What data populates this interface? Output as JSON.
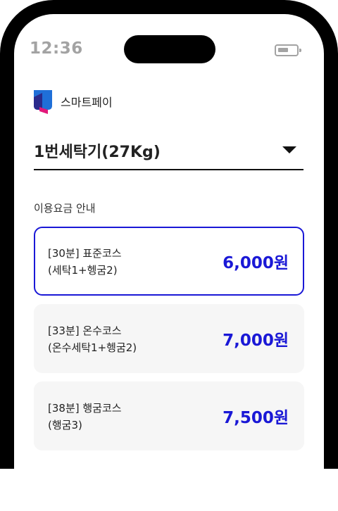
{
  "status_bar": {
    "time": "12:36"
  },
  "brand": {
    "name": "스마트페이"
  },
  "machine_select": {
    "label": "1번세탁기(27Kg)"
  },
  "section": {
    "title": "이용요금 안내"
  },
  "courses": [
    {
      "name": "[30분] 표준코스",
      "detail": "(세탁1+헹굼2)",
      "price": "6,000원",
      "selected": true
    },
    {
      "name": "[33분] 온수코스",
      "detail": "(온수세탁1+헹굼2)",
      "price": "7,000원",
      "selected": false
    },
    {
      "name": "[38분] 행굼코스",
      "detail": "(행굼3)",
      "price": "7,500원",
      "selected": false
    }
  ],
  "colors": {
    "accent": "#1a18d6",
    "card_bg": "#f6f6f6",
    "frame": "#000000"
  }
}
